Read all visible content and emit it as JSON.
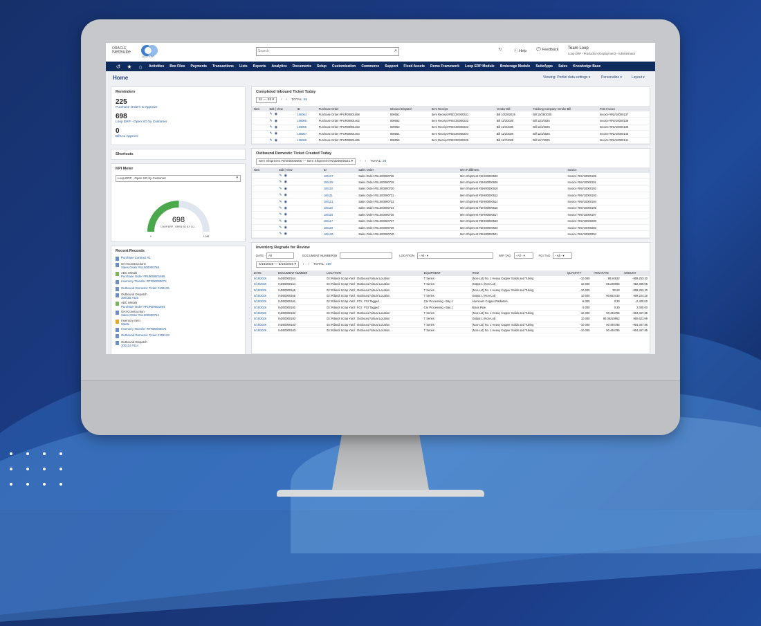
{
  "colors": {
    "nav": "#0f2a5c",
    "link": "#1d5aa3",
    "gauge": "#4aa84a"
  },
  "brand": {
    "oracle": "ORACLE",
    "netsuite": "NetSuite",
    "logo_text": "LOOP ERP"
  },
  "search": {
    "placeholder": "Search"
  },
  "topbar": {
    "help": "Help",
    "feedback": "Feedback",
    "user_name": "Team Loop",
    "user_role": "Loop ERP - Production (Deployment) - Administrator"
  },
  "nav": [
    "Activities",
    "Box Files",
    "Payments",
    "Transactions",
    "Lists",
    "Reports",
    "Analytics",
    "Documents",
    "Setup",
    "Customization",
    "Commerce",
    "Support",
    "Fixed Assets",
    "Demo Framework",
    "Loop ERP Module",
    "Brokerage Module",
    "SuiteApps",
    "Sales",
    "Knowledge Base"
  ],
  "page": {
    "title": "Home",
    "viewing": "Viewing: Portlet data settings",
    "personalize": "Personalize",
    "layout": "Layout"
  },
  "reminders": {
    "title": "Reminders",
    "items": [
      {
        "count": "225",
        "label": "Purchase Orders to Approve"
      },
      {
        "count": "698",
        "label": "Loop ERP - Open SO by Customer"
      },
      {
        "count": "0",
        "label": "Bills to Approve"
      }
    ]
  },
  "shortcuts": {
    "title": "Shortcuts"
  },
  "kpi": {
    "title": "KPI Meter",
    "select": "Loop ERP - Open SO by Customer",
    "value": "698",
    "min": "0",
    "max": "1,386",
    "label": "LOOP ERP - OPEN SO BY CU...",
    "fraction": 0.504
  },
  "recent": {
    "title": "Recent Records",
    "items": [
      {
        "icon": "doc",
        "title": "Purchase Contract #1",
        "sub": ""
      },
      {
        "icon": "doc",
        "title": "Sales Order #SLS00000756",
        "sub": "GHI Constructions"
      },
      {
        "icon": "green",
        "title": "Purchase Order #PUR00001565",
        "sub": "ABC Metals"
      },
      {
        "icon": "doc",
        "title": "Inventory Transfer #ITR00000072",
        "sub": ""
      },
      {
        "icon": "doc",
        "title": "Outbound Domestic Ticket #106135",
        "sub": ""
      },
      {
        "icon": "doc",
        "title": "300115 #115",
        "sub": "Outbound Dispatch"
      },
      {
        "icon": "green",
        "title": "Purchase Order #PUR00001564",
        "sub": "ABC Metals"
      },
      {
        "icon": "doc",
        "title": "Sales Order #SLS00000754",
        "sub": "GHI Construction"
      },
      {
        "icon": "orange",
        "title": "Waste",
        "sub": "Inventory Item"
      },
      {
        "icon": "doc",
        "title": "Inventory Transfer #ITR00000071",
        "sub": ""
      },
      {
        "icon": "doc",
        "title": "Outbound Domestic Ticket #106133",
        "sub": ""
      },
      {
        "icon": "doc",
        "title": "300114 #114",
        "sub": "Outbound Dispatch"
      }
    ]
  },
  "inbound": {
    "title": "Completed Inbound Ticket Today",
    "range": "51 — 55",
    "total_label": "TOTAL:",
    "total": "54",
    "headers": [
      "New",
      "Edit | View",
      "ID",
      "Purchase Order",
      "Inbound Dispatch",
      "Item Receipt",
      "Vendor Bill",
      "Tracking Company Vendor Bill",
      "FCB Invoice"
    ],
    "rows": [
      [
        "106064",
        "Purchase Order #PUR00001458",
        "000051",
        "Item Receipt #REC00000321",
        "Bill 10/28/2025",
        "Bill 10/28/2025",
        "Invoice #INV10000137"
      ],
      [
        "106065",
        "Purchase Order #PUR00001462",
        "000052",
        "Item Receipt #REC00000322",
        "Bill 11/3/2025",
        "Bill 11/3/2025",
        "Invoice #INV10000138"
      ],
      [
        "106066",
        "Purchase Order #PUR00001463",
        "000053",
        "Item Receipt #REC00000323",
        "Bill 11/3/2025",
        "Bill 11/3/2025",
        "Invoice #INV10000139"
      ],
      [
        "106067",
        "Purchase Order #PUR00001464",
        "000054",
        "Item Receipt #REC00000324",
        "Bill 11/3/2025",
        "Bill 11/3/2025",
        "Invoice #INV10000140"
      ],
      [
        "106068",
        "Purchase Order #PUR00001465",
        "000055",
        "Item Receipt #REC00000325",
        "Bill 11/7/2025",
        "Bill 11/7/2025",
        "Invoice #INV10000141"
      ]
    ]
  },
  "outbound": {
    "title": "Outbound Domestic Ticket Created Today",
    "range": "Item Shipment #shi00000500 — Item Shipment #shi00000521",
    "total_label": "TOTAL:",
    "total": "29",
    "headers": [
      "New",
      "Edit | View",
      "ID",
      "Sales Order",
      "Item Fulfillment",
      "Invoice"
    ],
    "rows": [
      [
        "106107",
        "Sales Order #SLS00000728",
        "Item Shipment #SHI00000500",
        "Invoice #INV10000189"
      ],
      [
        "106109",
        "Sales Order #SLS00000729",
        "Item Shipment #SHI00000505",
        "Invoice #INV10000191"
      ],
      [
        "106110",
        "Sales Order #SLS00000730",
        "Item Shipment #SHI00000510",
        "Invoice #INV10000192"
      ],
      [
        "106111",
        "Sales Order #SLS00000731",
        "Item Shipment #SHI00000512",
        "Invoice #INV10000193"
      ],
      [
        "106113",
        "Sales Order #SLS00000733",
        "Item Shipment #SHI00000514",
        "Invoice #INV10000194"
      ],
      [
        "106115",
        "Sales Order #SLS00000734",
        "Item Shipment #SHI00000516",
        "Invoice #INV10000196"
      ],
      [
        "106116",
        "Sales Order #SLS00000735",
        "Item Shipment #SHI00000517",
        "Invoice #INV10000197"
      ],
      [
        "106117",
        "Sales Order #SLS00000737",
        "Item Shipment #SHI00000519",
        "Invoice #INV10000200"
      ],
      [
        "106118",
        "Sales Order #SLS00000739",
        "Item Shipment #SHI00000520",
        "Invoice #INV10000203"
      ],
      [
        "106120",
        "Sales Order #SLS00000740",
        "Item Shipment #SHI00000521",
        "Invoice #INV10000204"
      ]
    ]
  },
  "regrade": {
    "title": "Inventory Regrade for Review",
    "filters": {
      "date_label": "DATE",
      "date_value": "All",
      "docnum_label": "DOCUMENT NUMBER/ID",
      "location_label": "LOCATION",
      "location_value": "- All -",
      "wip_label": "WIP TAG",
      "wip_value": "- All -",
      "fgi_label": "FGI TAG",
      "fgi_value": "- All -"
    },
    "range": "5/18/2026 — 5/18/2026",
    "total_label": "TOTAL:",
    "total": "199",
    "headers": [
      "DATE",
      "DOCUMENT NUMBER",
      "LOCATION",
      "EQUIPMENT",
      "ITEM",
      "QUANTITY",
      "ITEM RATE",
      "AMOUNT"
    ],
    "rows": [
      [
        "5/18/2026",
        "IAD00000164",
        "03: Rilandi Scrap Yard : Outbound Virtual Location",
        "T Series",
        "(Non-Lot) No. 1 Heavy Copper Solids and Tubing",
        "-10.000",
        "90.92532",
        "-909,253.20"
      ],
      [
        "5/18/2026",
        "IAD00000164",
        "03: Rilandi Scrap Yard : Outbound Virtual Location",
        "T Series",
        "Output 1 (Non-Lot)",
        "10.000",
        "96.230065",
        "962,300.65"
      ],
      [
        "5/18/2026",
        "IAD00000165",
        "03: Rilandi Scrap Yard : Outbound Virtual Location",
        "T Series",
        "(Non-Lot) No. 1 Heavy Copper Solids and Tubing",
        "-10.000",
        "90.93",
        "-909,253.20"
      ],
      [
        "5/18/2026",
        "IAD00000165",
        "03: Rilandi Scrap Yard : Outbound Virtual Location",
        "T Series",
        "Output 1 (Non-Lot)",
        "10.000",
        "90.922416",
        "909,224.16"
      ],
      [
        "5/18/2026",
        "IAD00000181",
        "03: Rilandi Scrap Yard : FGI : FGI Tagged",
        "Car Processing - Bay 1",
        "Aluminum Copper Radiators",
        "-8.000",
        "0.30",
        "-2,400.00"
      ],
      [
        "5/18/2026",
        "IAD00000181",
        "03: Rilandi Scrap Yard : FGI : FGI Tagged",
        "Car Processing - Bay 1",
        "Brass Pipe",
        "8.000",
        "0.30",
        "2,400.00"
      ],
      [
        "5/18/2026",
        "IAD00000182",
        "03: Rilandi Scrap Yard : Outbound Virtual Location",
        "T Series",
        "(Non-Lot) No. 1 Heavy Copper Solids and Tubing",
        "-10.000",
        "90.446785",
        "-904,467.85"
      ],
      [
        "5/18/2026",
        "IAD00000182",
        "03: Rilandi Scrap Yard : Outbound Virtual Location",
        "T Series",
        "Output 1 (Non-Lot)",
        "10.000",
        "90.06219962",
        "900,621.99"
      ],
      [
        "5/18/2026",
        "IAD00000183",
        "03: Rilandi Scrap Yard : Outbound Virtual Location",
        "T Series",
        "(Non-Lot) No. 1 Heavy Copper Solids and Tubing",
        "-10.000",
        "90.446785",
        "-904,467.85"
      ],
      [
        "5/18/2026",
        "IAD00000183",
        "03: Rilandi Scrap Yard : Outbound Virtual Location",
        "T Series",
        "(Non-Lot) No. 1 Heavy Copper Solids and Tubing",
        "-10.000",
        "90.446785",
        "-904,467.85"
      ]
    ]
  }
}
